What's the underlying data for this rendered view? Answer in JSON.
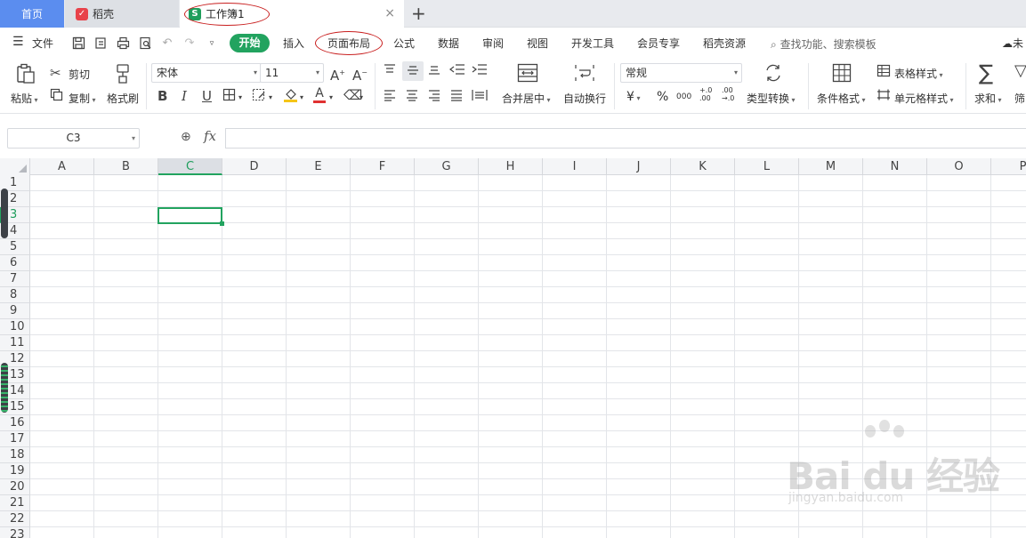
{
  "tabs": {
    "home": "首页",
    "daoke": "稻壳",
    "workbook": "工作簿1",
    "close_glyph": "×",
    "add_glyph": "+"
  },
  "menu": {
    "file": "文件",
    "start": "开始",
    "items": [
      "插入",
      "页面布局",
      "公式",
      "数据",
      "审阅",
      "视图",
      "开发工具",
      "会员专享",
      "稻壳资源"
    ],
    "search": "查找功能、搜索模板",
    "cloud": "未"
  },
  "ribbon": {
    "paste": "粘贴",
    "cut": "剪切",
    "copy": "复制",
    "format_painter": "格式刷",
    "font_name": "宋体",
    "font_size": "11",
    "bold": "B",
    "italic": "I",
    "underline": "U",
    "font_color_glyph": "A",
    "merge_center": "合并居中",
    "wrap_text": "自动换行",
    "number_format": "常规",
    "currency": "¥",
    "percent": "%",
    "thousands": "000",
    "inc_decimal": "+.0 .00",
    "dec_decimal": ".00 →.0",
    "type_convert": "类型转换",
    "cond_format": "条件格式",
    "table_style": "表格样式",
    "cell_style": "单元格样式",
    "sum": "求和",
    "filter": "筛"
  },
  "formula_bar": {
    "name_box": "C3",
    "fx": "fx",
    "value": ""
  },
  "grid": {
    "columns": [
      "A",
      "B",
      "C",
      "D",
      "E",
      "F",
      "G",
      "H",
      "I",
      "J",
      "K",
      "L",
      "M",
      "N",
      "O",
      "P"
    ],
    "rows": [
      "1",
      "2",
      "3",
      "4",
      "5",
      "6",
      "7",
      "8",
      "9",
      "10",
      "11",
      "12",
      "13",
      "14",
      "15",
      "16",
      "17",
      "18",
      "19",
      "20",
      "21",
      "22",
      "23"
    ],
    "selected_column": "C",
    "selected_row": "3"
  },
  "watermark": {
    "logo": "Bai du 经验",
    "url": "jingyan.baidu.com"
  },
  "colors": {
    "accent": "#22a35f",
    "home_tab": "#5b8def",
    "highlight_oval": "#c81e1e"
  }
}
